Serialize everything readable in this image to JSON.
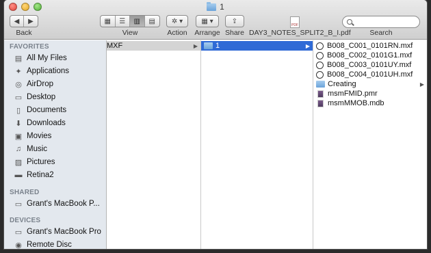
{
  "window": {
    "title": "1"
  },
  "toolbar": {
    "back_label": "Back",
    "view_label": "View",
    "action_label": "Action",
    "arrange_label": "Arrange",
    "share_label": "Share",
    "file_label": "DAY3_NOTES_SPLIT2_B_I.pdf",
    "search_label": "Search"
  },
  "sidebar": {
    "favorites_header": "FAVORITES",
    "favorites": [
      {
        "label": "All My Files",
        "icon": "all-files-icon"
      },
      {
        "label": "Applications",
        "icon": "applications-icon"
      },
      {
        "label": "AirDrop",
        "icon": "airdrop-icon"
      },
      {
        "label": "Desktop",
        "icon": "desktop-icon"
      },
      {
        "label": "Documents",
        "icon": "documents-icon"
      },
      {
        "label": "Downloads",
        "icon": "downloads-icon"
      },
      {
        "label": "Movies",
        "icon": "movies-icon"
      },
      {
        "label": "Music",
        "icon": "music-icon"
      },
      {
        "label": "Pictures",
        "icon": "pictures-icon"
      },
      {
        "label": "Retina2",
        "icon": "drive-icon"
      }
    ],
    "shared_header": "SHARED",
    "shared": [
      {
        "label": "Grant's MacBook P..."
      }
    ],
    "devices_header": "DEVICES",
    "devices": [
      {
        "label": "Grant's MacBook Pro"
      },
      {
        "label": "Remote Disc"
      }
    ]
  },
  "columns": {
    "col1": [
      "MXF"
    ],
    "col2": [
      "1"
    ],
    "col3": [
      {
        "label": "B008_C001_0101RN.mxf",
        "kind": "mxf"
      },
      {
        "label": "B008_C002_0101G1.mxf",
        "kind": "mxf"
      },
      {
        "label": "B008_C003_0101UY.mxf",
        "kind": "mxf"
      },
      {
        "label": "B008_C004_0101UH.mxf",
        "kind": "mxf"
      },
      {
        "label": "Creating",
        "kind": "folder"
      },
      {
        "label": "msmFMID.pmr",
        "kind": "doc"
      },
      {
        "label": "msmMMOB.mdb",
        "kind": "doc"
      }
    ]
  },
  "colors": {
    "selection": "#2f6ad6",
    "sidebar_bg": "#e3e8ee"
  }
}
